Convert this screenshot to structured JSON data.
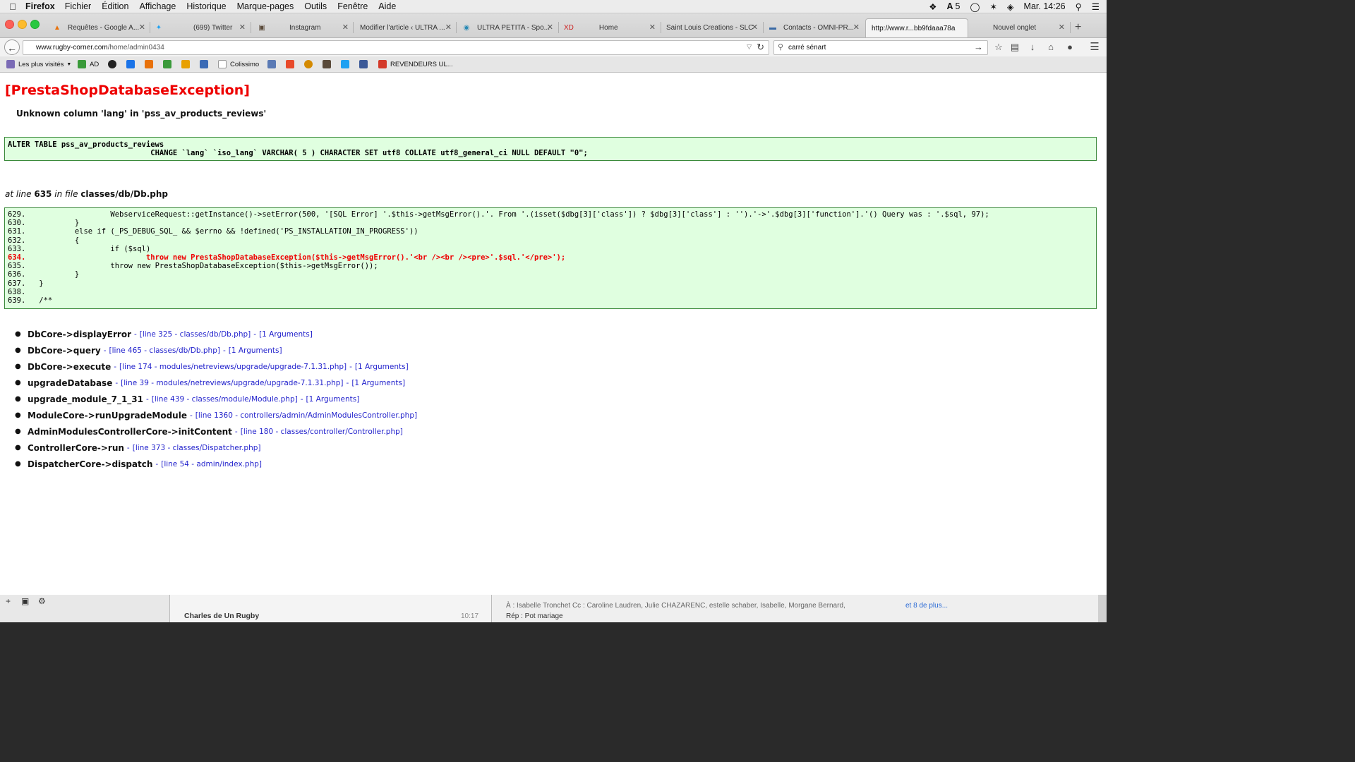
{
  "menubar": {
    "app_name": "Firefox",
    "items": [
      "Fichier",
      "Édition",
      "Affichage",
      "Historique",
      "Marque-pages",
      "Outils",
      "Fenêtre",
      "Aide"
    ],
    "status_count": "5",
    "clock": "Mar. 14:26"
  },
  "tabs": [
    {
      "label": "Requêtes - Google A...",
      "icon": "analytics-icon",
      "color": "#e8710a"
    },
    {
      "label": "(699) Twitter",
      "icon": "twitter-icon",
      "color": "#1da1f2"
    },
    {
      "label": "Instagram",
      "icon": "instagram-icon",
      "color": "#5a4a3a"
    },
    {
      "label": "Modifier l'article ‹ ULTRA ...",
      "icon": "",
      "color": ""
    },
    {
      "label": "ULTRA PETITA - Spo...",
      "icon": "globe-icon",
      "color": "#2a8ab5"
    },
    {
      "label": "XD",
      "icon": "",
      "color": "#cc2222"
    },
    {
      "label": "Home",
      "icon": "",
      "color": ""
    },
    {
      "label": "Saint Louis Creations - SLC",
      "icon": "",
      "color": ""
    },
    {
      "label": "Contacts - OMNI-PR...",
      "icon": "omni-icon",
      "color": "#3a6aa5"
    },
    {
      "label": "http://www.r...bb9fdaaa78a",
      "icon": "",
      "color": ""
    },
    {
      "label": "Nouvel onglet",
      "icon": "",
      "color": ""
    }
  ],
  "navbar": {
    "url_domain": "www.rugby-corner.com",
    "url_path": "/home/admin0434",
    "search_value": "carré sénart"
  },
  "bookmarks": [
    {
      "label": "Les plus visités",
      "icon": "folder-icon",
      "color": "#7a6ab5"
    },
    {
      "label": "AD",
      "icon": "ad-icon",
      "color": "#3a9a3a"
    },
    {
      "label": "",
      "icon": "circle-icon",
      "color": "#222222"
    },
    {
      "label": "",
      "icon": "adwords-icon",
      "color": "#1a73e8"
    },
    {
      "label": "",
      "icon": "analytics-icon",
      "color": "#e8710a"
    },
    {
      "label": "",
      "icon": "green-icon",
      "color": "#3a9a3a"
    },
    {
      "label": "",
      "icon": "cone-icon",
      "color": "#e8a000"
    },
    {
      "label": "",
      "icon": "site-icon",
      "color": "#3a6ab5"
    },
    {
      "label": "Colissimo",
      "icon": "page-icon",
      "color": "#dddddd"
    },
    {
      "label": "",
      "icon": "print-icon",
      "color": "#5a7ab5"
    },
    {
      "label": "",
      "icon": "joomla-icon",
      "color": "#e84a2a"
    },
    {
      "label": "",
      "icon": "ring-icon",
      "color": "#d48a00"
    },
    {
      "label": "",
      "icon": "instagram-icon",
      "color": "#5a4a3a"
    },
    {
      "label": "",
      "icon": "twitter-icon",
      "color": "#1da1f2"
    },
    {
      "label": "",
      "icon": "facebook-icon",
      "color": "#3b5998"
    },
    {
      "label": "REVENDEURS UL...",
      "icon": "pin-icon",
      "color": "#d43a2a"
    }
  ],
  "error": {
    "title": "[PrestaShopDatabaseException]",
    "message": "Unknown column 'lang' in 'pss_av_products_reviews'",
    "sql_lines": [
      "ALTER TABLE pss_av_products_reviews",
      "                                CHANGE `lang` `iso_lang` VARCHAR( 5 ) CHARACTER SET utf8 COLLATE utf8_general_ci NULL DEFAULT \"0\";"
    ],
    "at_line_prefix": "at line",
    "line_number": "635",
    "in_file_label": "in file",
    "file": "classes/db/Db.php"
  },
  "source": {
    "highlight_line": "634.",
    "lines": [
      "629.                   WebserviceRequest::getInstance()->setError(500, '[SQL Error] '.$this->getMsgError().'. From '.(isset($dbg[3]['class']) ? $dbg[3]['class'] : '').'->'.$dbg[3]['function'].'() Query was : '.$sql, 97);",
      "630.           }",
      "631.           else if (_PS_DEBUG_SQL_ && $errno && !defined('PS_INSTALLATION_IN_PROGRESS'))",
      "632.           {",
      "633.                   if ($sql)",
      "634.                           throw new PrestaShopDatabaseException($this->getMsgError().'<br /><br /><pre>'.$sql.'</pre>');",
      "635.                   throw new PrestaShopDatabaseException($this->getMsgError());",
      "636.           }",
      "637.   }",
      "638.",
      "639.   /**"
    ]
  },
  "trace": [
    {
      "fn": "DbCore->displayError",
      "loc": "[line 325 - classes/db/Db.php]",
      "args": "[1 Arguments]"
    },
    {
      "fn": "DbCore->query",
      "loc": "[line 465 - classes/db/Db.php]",
      "args": "[1 Arguments]"
    },
    {
      "fn": "DbCore->execute",
      "loc": "[line 174 - modules/netreviews/upgrade/upgrade-7.1.31.php]",
      "args": "[1 Arguments]"
    },
    {
      "fn": "upgradeDatabase",
      "loc": "[line 39 - modules/netreviews/upgrade/upgrade-7.1.31.php]",
      "args": "[1 Arguments]"
    },
    {
      "fn": "upgrade_module_7_1_31",
      "loc": "[line 439 - classes/module/Module.php]",
      "args": "[1 Arguments]"
    },
    {
      "fn": "ModuleCore->runUpgradeModule",
      "loc": "[line 1360 - controllers/admin/AdminModulesController.php]",
      "args": ""
    },
    {
      "fn": "AdminModulesControllerCore->initContent",
      "loc": "[line 180 - classes/controller/Controller.php]",
      "args": ""
    },
    {
      "fn": "ControllerCore->run",
      "loc": "[line 373 - classes/Dispatcher.php]",
      "args": ""
    },
    {
      "fn": "DispatcherCore->dispatch",
      "loc": "[line 54 - admin/index.php]",
      "args": ""
    }
  ],
  "background_app": {
    "sender": "Charles de Un Rugby",
    "time": "10:17",
    "recipients": "À : Isabelle Tronchet   Cc : Caroline Laudren,   Julie CHAZARENC,   estelle schaber,   Isabelle,   Morgane Bernard,",
    "more": "et 8 de plus...",
    "subject": "Rép : Pot mariage"
  }
}
